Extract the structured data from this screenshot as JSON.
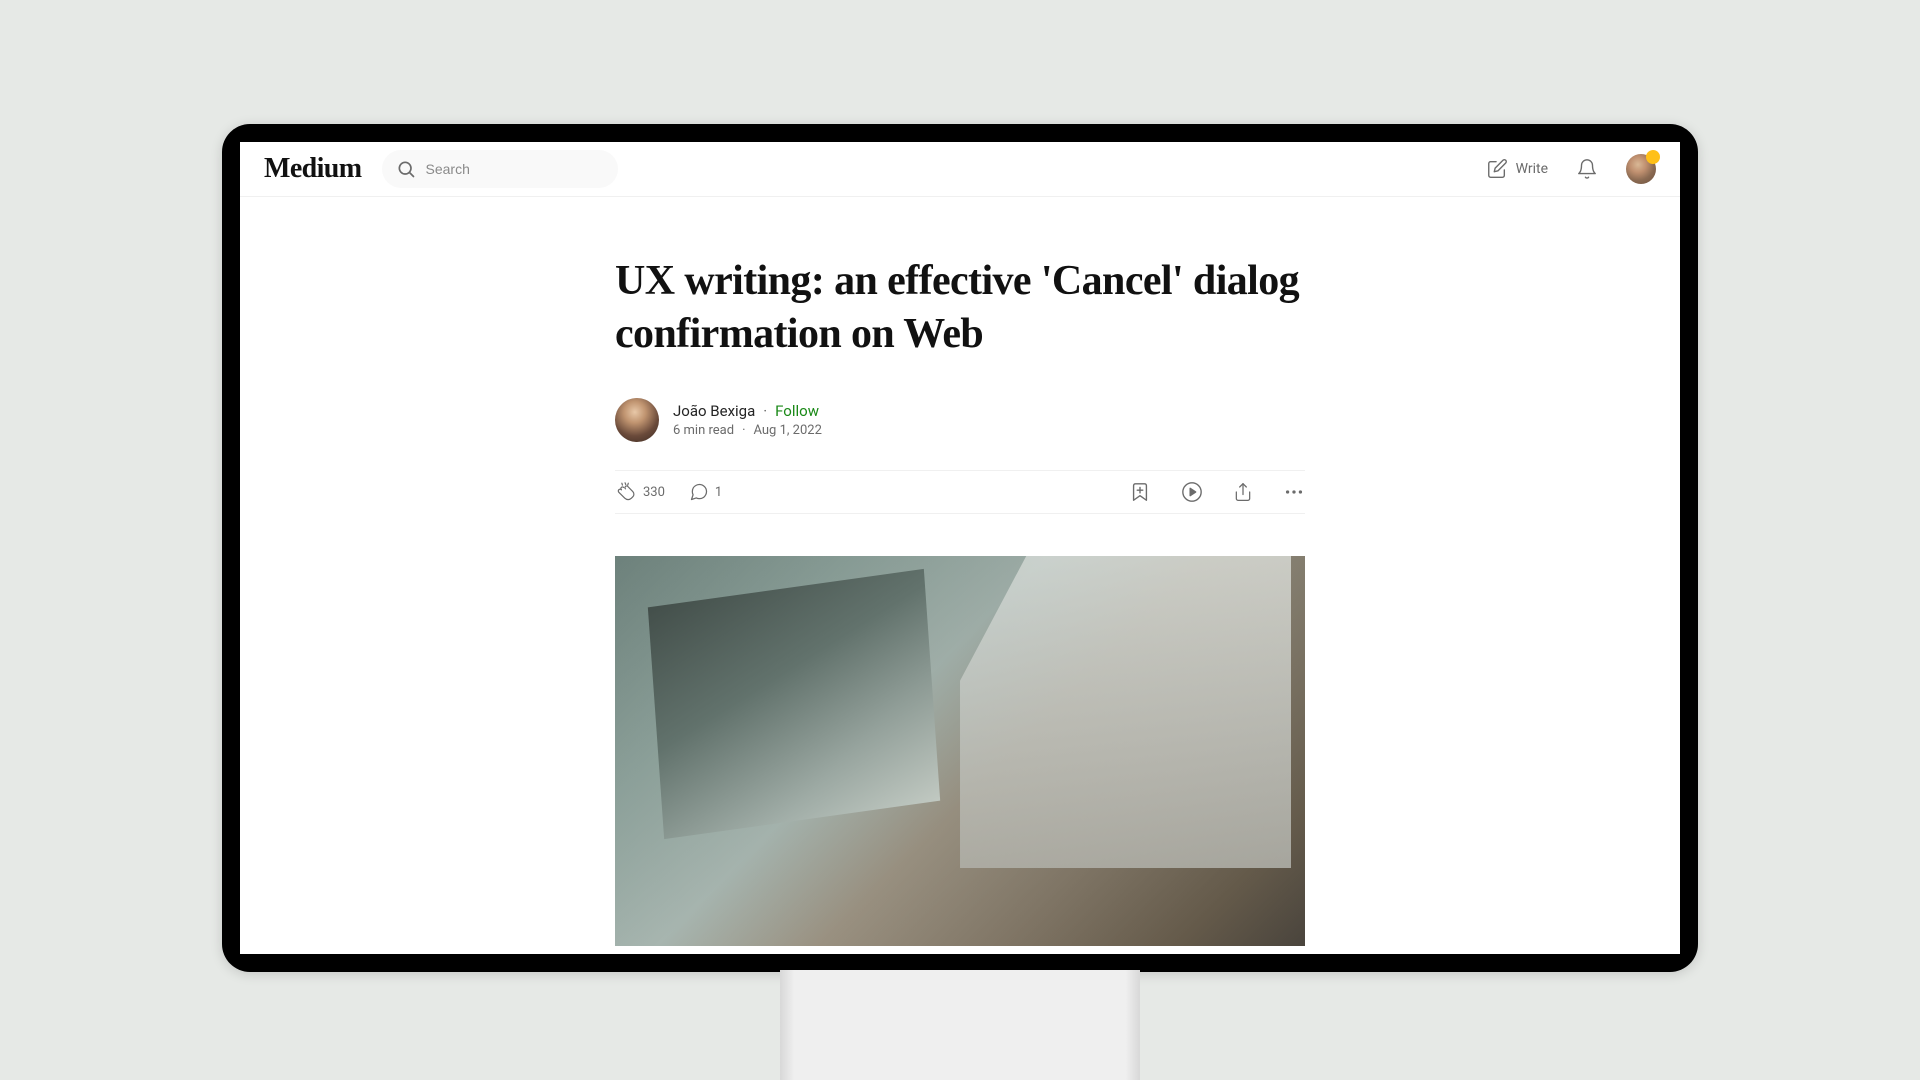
{
  "header": {
    "logo": "Medium",
    "search_placeholder": "Search",
    "write_label": "Write"
  },
  "article": {
    "title": "UX writing: an effective 'Cancel' dialog confirmation on Web",
    "author_name": "João Bexiga",
    "follow_label": "Follow",
    "read_time": "6 min read",
    "publish_date": "Aug 1, 2022"
  },
  "actions": {
    "claps_count": "330",
    "responses_count": "1"
  }
}
